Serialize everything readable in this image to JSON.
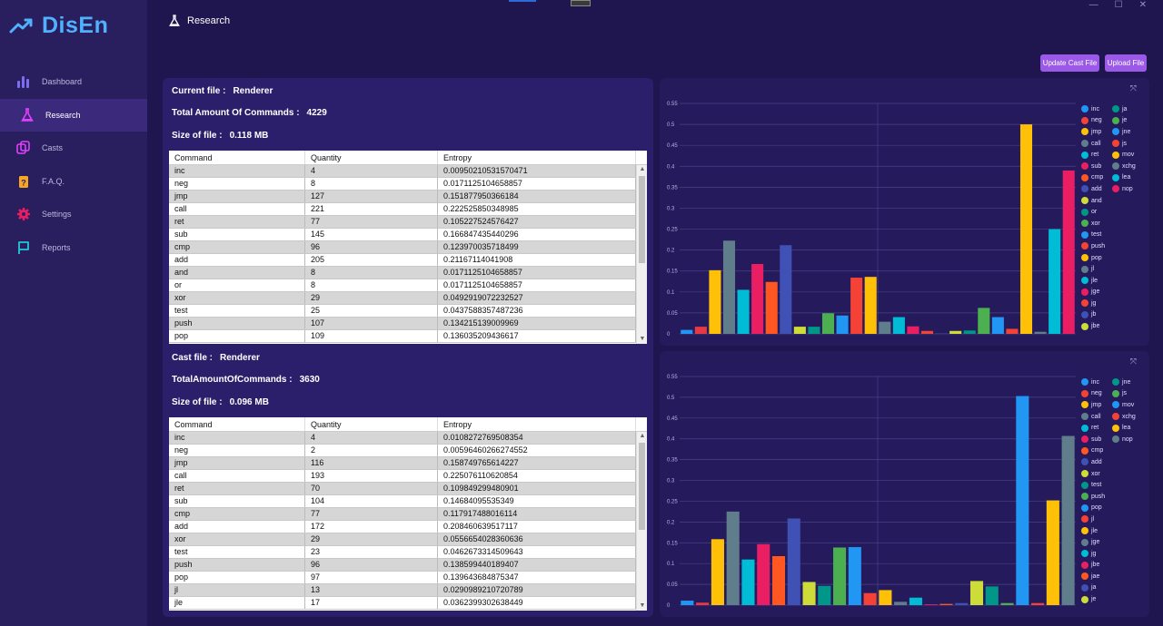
{
  "app": {
    "name": "DisEn",
    "accent": "#4fb1ff"
  },
  "nav": [
    {
      "label": "Dashboard",
      "icon": "bar-chart-icon",
      "active": false
    },
    {
      "label": "Research",
      "icon": "flask-icon",
      "active": true
    },
    {
      "label": "Casts",
      "icon": "copy-icon",
      "active": false
    },
    {
      "label": "F.A.Q.",
      "icon": "question-icon",
      "active": false
    },
    {
      "label": "Settings",
      "icon": "gear-icon",
      "active": false
    },
    {
      "label": "Reports",
      "icon": "flag-icon",
      "active": false
    }
  ],
  "page": {
    "title": "Research"
  },
  "window": {
    "minimize": "—",
    "maximize": "☐",
    "close": "✕"
  },
  "actions": {
    "update_label": "Update Cast File",
    "upload_label": "Upload File"
  },
  "current": {
    "file_label": "Current file :",
    "file_value": "Renderer",
    "total_label": "Total Amount Of Commands :",
    "total_value": "4229",
    "size_label": "Size of file :",
    "size_value": "0.118 MB",
    "columns": [
      "Command",
      "Quantity",
      "Entropy"
    ],
    "rows": [
      [
        "inc",
        "4",
        "0.00950210531570471"
      ],
      [
        "neg",
        "8",
        "0.0171125104658857"
      ],
      [
        "jmp",
        "127",
        "0.151877950366184"
      ],
      [
        "call",
        "221",
        "0.222525850348985"
      ],
      [
        "ret",
        "77",
        "0.105227524576427"
      ],
      [
        "sub",
        "145",
        "0.166847435440296"
      ],
      [
        "cmp",
        "96",
        "0.123970035718499"
      ],
      [
        "add",
        "205",
        "0.21167114041908"
      ],
      [
        "and",
        "8",
        "0.0171125104658857"
      ],
      [
        "or",
        "8",
        "0.0171125104658857"
      ],
      [
        "xor",
        "29",
        "0.0492919072232527"
      ],
      [
        "test",
        "25",
        "0.0437588357487236"
      ],
      [
        "push",
        "107",
        "0.134215139009969"
      ],
      [
        "pop",
        "109",
        "0.136035209436617"
      ]
    ]
  },
  "cast": {
    "file_label": "Cast file :",
    "file_value": "Renderer",
    "total_label": "TotalAmountOfCommands :",
    "total_value": "3630",
    "size_label": "Size of file :",
    "size_value": "0.096 MB",
    "columns": [
      "Command",
      "Quantity",
      "Entropy"
    ],
    "rows": [
      [
        "inc",
        "4",
        "0.0108272769508354"
      ],
      [
        "neg",
        "2",
        "0.00596460266274552"
      ],
      [
        "jmp",
        "116",
        "0.158749765614227"
      ],
      [
        "call",
        "193",
        "0.225076110620854"
      ],
      [
        "ret",
        "70",
        "0.109849299480901"
      ],
      [
        "sub",
        "104",
        "0.14684095535349"
      ],
      [
        "cmp",
        "77",
        "0.117917488016114"
      ],
      [
        "add",
        "172",
        "0.208460639517117"
      ],
      [
        "xor",
        "29",
        "0.0556654028360636"
      ],
      [
        "test",
        "23",
        "0.0462673314509643"
      ],
      [
        "push",
        "96",
        "0.138599440189407"
      ],
      [
        "pop",
        "97",
        "0.139643684875347"
      ],
      [
        "jl",
        "13",
        "0.0290989210720789"
      ],
      [
        "jle",
        "17",
        "0.0362399302638449"
      ]
    ]
  },
  "chart_data": [
    {
      "type": "bar",
      "ylim": [
        0,
        0.55
      ],
      "yticks": [
        "0",
        "0.05",
        "0.1",
        "0.15",
        "0.2",
        "0.25",
        "0.3",
        "0.35",
        "0.4",
        "0.45",
        "0.5",
        "0.55"
      ],
      "grid": true,
      "legend": "right",
      "categories": [
        "inc",
        "neg",
        "jmp",
        "call",
        "ret",
        "sub",
        "cmp",
        "add",
        "and",
        "or",
        "xor",
        "test",
        "push",
        "pop",
        "jl",
        "jle",
        "jge",
        "jg",
        "jb",
        "jbe",
        "ja",
        "je",
        "jne",
        "js",
        "mov",
        "xchg",
        "lea",
        "nop"
      ],
      "values": [
        0.0095,
        0.0171,
        0.1519,
        0.2225,
        0.1052,
        0.1668,
        0.124,
        0.2117,
        0.0171,
        0.0171,
        0.0493,
        0.0438,
        0.1342,
        0.136,
        0.029,
        0.04,
        0.018,
        0.007,
        0.001,
        0.007,
        0.008,
        0.062,
        0.04,
        0.012,
        0.5,
        0.005,
        0.25,
        0.39
      ],
      "colors": [
        "#2196f3",
        "#e53945",
        "#ffc107",
        "#607d8b",
        "#00bcd4",
        "#e91e63",
        "#ff5722",
        "#3f51b5",
        "#cddc39",
        "#009688",
        "#4caf50",
        "#2196f3",
        "#f44336",
        "#ffc107",
        "#607d8b",
        "#00bcd4",
        "#e91e63",
        "#f44336",
        "#3f51b5",
        "#cddc39",
        "#009688",
        "#4caf50",
        "#2196f3",
        "#f44336",
        "#ffc107",
        "#607d8b",
        "#00bcd4",
        "#e91e63"
      ]
    },
    {
      "type": "bar",
      "ylim": [
        0,
        0.55
      ],
      "yticks": [
        "0",
        "0.05",
        "0.1",
        "0.15",
        "0.2",
        "0.25",
        "0.3",
        "0.35",
        "0.4",
        "0.45",
        "0.5",
        "0.55"
      ],
      "grid": true,
      "legend": "right",
      "categories": [
        "inc",
        "neg",
        "jmp",
        "call",
        "ret",
        "sub",
        "cmp",
        "add",
        "xor",
        "test",
        "push",
        "pop",
        "jl",
        "jle",
        "jge",
        "jg",
        "jbe",
        "jae",
        "ja",
        "je",
        "jne",
        "js",
        "mov",
        "xchg",
        "lea",
        "nop"
      ],
      "values": [
        0.0108,
        0.006,
        0.1587,
        0.2251,
        0.1098,
        0.1468,
        0.1179,
        0.2085,
        0.0557,
        0.0463,
        0.1386,
        0.1396,
        0.029,
        0.0362,
        0.008,
        0.018,
        0.002,
        0.003,
        0.005,
        0.058,
        0.045,
        0.005,
        0.503,
        0.005,
        0.252,
        0.407
      ],
      "colors": [
        "#2196f3",
        "#e53945",
        "#ffc107",
        "#607d8b",
        "#00bcd4",
        "#e91e63",
        "#ff5722",
        "#3f51b5",
        "#cddc39",
        "#009688",
        "#4caf50",
        "#2196f3",
        "#f44336",
        "#ffc107",
        "#607d8b",
        "#00bcd4",
        "#e91e63",
        "#ff5722",
        "#3f51b5",
        "#cddc39",
        "#009688",
        "#4caf50",
        "#2196f3",
        "#f44336",
        "#ffc107",
        "#607d8b"
      ]
    }
  ],
  "legends": [
    {
      "items": [
        {
          "label": "inc",
          "color": "#2196f3"
        },
        {
          "label": "ja",
          "color": "#009688"
        },
        {
          "label": "neg",
          "color": "#f44336"
        },
        {
          "label": "je",
          "color": "#4caf50"
        },
        {
          "label": "jmp",
          "color": "#ffc107"
        },
        {
          "label": "jne",
          "color": "#2196f3"
        },
        {
          "label": "call",
          "color": "#607d8b"
        },
        {
          "label": "js",
          "color": "#f44336"
        },
        {
          "label": "ret",
          "color": "#00bcd4"
        },
        {
          "label": "mov",
          "color": "#ffc107"
        },
        {
          "label": "sub",
          "color": "#e91e63"
        },
        {
          "label": "xchg",
          "color": "#607d8b"
        },
        {
          "label": "cmp",
          "color": "#ff5722"
        },
        {
          "label": "lea",
          "color": "#00bcd4"
        },
        {
          "label": "add",
          "color": "#3f51b5"
        },
        {
          "label": "nop",
          "color": "#e91e63"
        },
        {
          "label": "and",
          "color": "#cddc39"
        },
        {
          "label": "",
          "color": ""
        },
        {
          "label": "or",
          "color": "#009688"
        },
        {
          "label": "",
          "color": ""
        },
        {
          "label": "xor",
          "color": "#4caf50"
        },
        {
          "label": "",
          "color": ""
        },
        {
          "label": "test",
          "color": "#2196f3"
        },
        {
          "label": "",
          "color": ""
        },
        {
          "label": "push",
          "color": "#f44336"
        },
        {
          "label": "",
          "color": ""
        },
        {
          "label": "pop",
          "color": "#ffc107"
        },
        {
          "label": "",
          "color": ""
        },
        {
          "label": "jl",
          "color": "#607d8b"
        },
        {
          "label": "",
          "color": ""
        },
        {
          "label": "jle",
          "color": "#00bcd4"
        },
        {
          "label": "",
          "color": ""
        },
        {
          "label": "jge",
          "color": "#e91e63"
        },
        {
          "label": "",
          "color": ""
        },
        {
          "label": "jg",
          "color": "#f44336"
        },
        {
          "label": "",
          "color": ""
        },
        {
          "label": "jb",
          "color": "#3f51b5"
        },
        {
          "label": "",
          "color": ""
        },
        {
          "label": "jbe",
          "color": "#cddc39"
        },
        {
          "label": "",
          "color": ""
        }
      ]
    },
    {
      "items": [
        {
          "label": "inc",
          "color": "#2196f3"
        },
        {
          "label": "jne",
          "color": "#009688"
        },
        {
          "label": "neg",
          "color": "#f44336"
        },
        {
          "label": "js",
          "color": "#4caf50"
        },
        {
          "label": "jmp",
          "color": "#ffc107"
        },
        {
          "label": "mov",
          "color": "#2196f3"
        },
        {
          "label": "call",
          "color": "#607d8b"
        },
        {
          "label": "xchg",
          "color": "#f44336"
        },
        {
          "label": "ret",
          "color": "#00bcd4"
        },
        {
          "label": "lea",
          "color": "#ffc107"
        },
        {
          "label": "sub",
          "color": "#e91e63"
        },
        {
          "label": "nop",
          "color": "#607d8b"
        },
        {
          "label": "cmp",
          "color": "#ff5722"
        },
        {
          "label": "",
          "color": ""
        },
        {
          "label": "add",
          "color": "#3f51b5"
        },
        {
          "label": "",
          "color": ""
        },
        {
          "label": "xor",
          "color": "#cddc39"
        },
        {
          "label": "",
          "color": ""
        },
        {
          "label": "test",
          "color": "#009688"
        },
        {
          "label": "",
          "color": ""
        },
        {
          "label": "push",
          "color": "#4caf50"
        },
        {
          "label": "",
          "color": ""
        },
        {
          "label": "pop",
          "color": "#2196f3"
        },
        {
          "label": "",
          "color": ""
        },
        {
          "label": "jl",
          "color": "#f44336"
        },
        {
          "label": "",
          "color": ""
        },
        {
          "label": "jle",
          "color": "#ffc107"
        },
        {
          "label": "",
          "color": ""
        },
        {
          "label": "jge",
          "color": "#607d8b"
        },
        {
          "label": "",
          "color": ""
        },
        {
          "label": "jg",
          "color": "#00bcd4"
        },
        {
          "label": "",
          "color": ""
        },
        {
          "label": "jbe",
          "color": "#e91e63"
        },
        {
          "label": "",
          "color": ""
        },
        {
          "label": "jae",
          "color": "#ff5722"
        },
        {
          "label": "",
          "color": ""
        },
        {
          "label": "ja",
          "color": "#3f51b5"
        },
        {
          "label": "",
          "color": ""
        },
        {
          "label": "je",
          "color": "#cddc39"
        },
        {
          "label": "",
          "color": ""
        }
      ]
    }
  ]
}
